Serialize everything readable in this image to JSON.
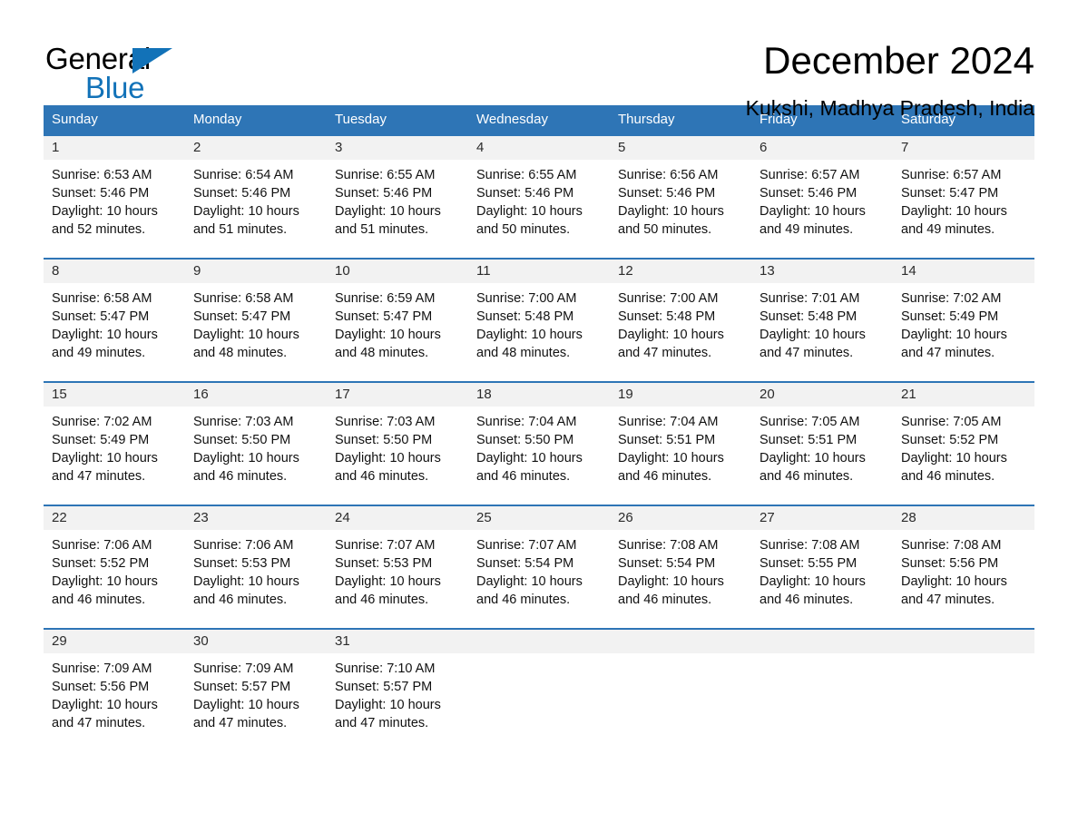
{
  "brand": {
    "name_part1": "General",
    "name_part2": "Blue",
    "accent_color": "#1272b8",
    "header_color": "#2e75b6"
  },
  "header": {
    "title": "December 2024",
    "location": "Kukshi, Madhya Pradesh, India"
  },
  "calendar": {
    "day_headers": [
      "Sunday",
      "Monday",
      "Tuesday",
      "Wednesday",
      "Thursday",
      "Friday",
      "Saturday"
    ],
    "weeks": [
      [
        {
          "day": "1",
          "sunrise": "Sunrise: 6:53 AM",
          "sunset": "Sunset: 5:46 PM",
          "daylight_line1": "Daylight: 10 hours",
          "daylight_line2": "and 52 minutes."
        },
        {
          "day": "2",
          "sunrise": "Sunrise: 6:54 AM",
          "sunset": "Sunset: 5:46 PM",
          "daylight_line1": "Daylight: 10 hours",
          "daylight_line2": "and 51 minutes."
        },
        {
          "day": "3",
          "sunrise": "Sunrise: 6:55 AM",
          "sunset": "Sunset: 5:46 PM",
          "daylight_line1": "Daylight: 10 hours",
          "daylight_line2": "and 51 minutes."
        },
        {
          "day": "4",
          "sunrise": "Sunrise: 6:55 AM",
          "sunset": "Sunset: 5:46 PM",
          "daylight_line1": "Daylight: 10 hours",
          "daylight_line2": "and 50 minutes."
        },
        {
          "day": "5",
          "sunrise": "Sunrise: 6:56 AM",
          "sunset": "Sunset: 5:46 PM",
          "daylight_line1": "Daylight: 10 hours",
          "daylight_line2": "and 50 minutes."
        },
        {
          "day": "6",
          "sunrise": "Sunrise: 6:57 AM",
          "sunset": "Sunset: 5:46 PM",
          "daylight_line1": "Daylight: 10 hours",
          "daylight_line2": "and 49 minutes."
        },
        {
          "day": "7",
          "sunrise": "Sunrise: 6:57 AM",
          "sunset": "Sunset: 5:47 PM",
          "daylight_line1": "Daylight: 10 hours",
          "daylight_line2": "and 49 minutes."
        }
      ],
      [
        {
          "day": "8",
          "sunrise": "Sunrise: 6:58 AM",
          "sunset": "Sunset: 5:47 PM",
          "daylight_line1": "Daylight: 10 hours",
          "daylight_line2": "and 49 minutes."
        },
        {
          "day": "9",
          "sunrise": "Sunrise: 6:58 AM",
          "sunset": "Sunset: 5:47 PM",
          "daylight_line1": "Daylight: 10 hours",
          "daylight_line2": "and 48 minutes."
        },
        {
          "day": "10",
          "sunrise": "Sunrise: 6:59 AM",
          "sunset": "Sunset: 5:47 PM",
          "daylight_line1": "Daylight: 10 hours",
          "daylight_line2": "and 48 minutes."
        },
        {
          "day": "11",
          "sunrise": "Sunrise: 7:00 AM",
          "sunset": "Sunset: 5:48 PM",
          "daylight_line1": "Daylight: 10 hours",
          "daylight_line2": "and 48 minutes."
        },
        {
          "day": "12",
          "sunrise": "Sunrise: 7:00 AM",
          "sunset": "Sunset: 5:48 PM",
          "daylight_line1": "Daylight: 10 hours",
          "daylight_line2": "and 47 minutes."
        },
        {
          "day": "13",
          "sunrise": "Sunrise: 7:01 AM",
          "sunset": "Sunset: 5:48 PM",
          "daylight_line1": "Daylight: 10 hours",
          "daylight_line2": "and 47 minutes."
        },
        {
          "day": "14",
          "sunrise": "Sunrise: 7:02 AM",
          "sunset": "Sunset: 5:49 PM",
          "daylight_line1": "Daylight: 10 hours",
          "daylight_line2": "and 47 minutes."
        }
      ],
      [
        {
          "day": "15",
          "sunrise": "Sunrise: 7:02 AM",
          "sunset": "Sunset: 5:49 PM",
          "daylight_line1": "Daylight: 10 hours",
          "daylight_line2": "and 47 minutes."
        },
        {
          "day": "16",
          "sunrise": "Sunrise: 7:03 AM",
          "sunset": "Sunset: 5:50 PM",
          "daylight_line1": "Daylight: 10 hours",
          "daylight_line2": "and 46 minutes."
        },
        {
          "day": "17",
          "sunrise": "Sunrise: 7:03 AM",
          "sunset": "Sunset: 5:50 PM",
          "daylight_line1": "Daylight: 10 hours",
          "daylight_line2": "and 46 minutes."
        },
        {
          "day": "18",
          "sunrise": "Sunrise: 7:04 AM",
          "sunset": "Sunset: 5:50 PM",
          "daylight_line1": "Daylight: 10 hours",
          "daylight_line2": "and 46 minutes."
        },
        {
          "day": "19",
          "sunrise": "Sunrise: 7:04 AM",
          "sunset": "Sunset: 5:51 PM",
          "daylight_line1": "Daylight: 10 hours",
          "daylight_line2": "and 46 minutes."
        },
        {
          "day": "20",
          "sunrise": "Sunrise: 7:05 AM",
          "sunset": "Sunset: 5:51 PM",
          "daylight_line1": "Daylight: 10 hours",
          "daylight_line2": "and 46 minutes."
        },
        {
          "day": "21",
          "sunrise": "Sunrise: 7:05 AM",
          "sunset": "Sunset: 5:52 PM",
          "daylight_line1": "Daylight: 10 hours",
          "daylight_line2": "and 46 minutes."
        }
      ],
      [
        {
          "day": "22",
          "sunrise": "Sunrise: 7:06 AM",
          "sunset": "Sunset: 5:52 PM",
          "daylight_line1": "Daylight: 10 hours",
          "daylight_line2": "and 46 minutes."
        },
        {
          "day": "23",
          "sunrise": "Sunrise: 7:06 AM",
          "sunset": "Sunset: 5:53 PM",
          "daylight_line1": "Daylight: 10 hours",
          "daylight_line2": "and 46 minutes."
        },
        {
          "day": "24",
          "sunrise": "Sunrise: 7:07 AM",
          "sunset": "Sunset: 5:53 PM",
          "daylight_line1": "Daylight: 10 hours",
          "daylight_line2": "and 46 minutes."
        },
        {
          "day": "25",
          "sunrise": "Sunrise: 7:07 AM",
          "sunset": "Sunset: 5:54 PM",
          "daylight_line1": "Daylight: 10 hours",
          "daylight_line2": "and 46 minutes."
        },
        {
          "day": "26",
          "sunrise": "Sunrise: 7:08 AM",
          "sunset": "Sunset: 5:54 PM",
          "daylight_line1": "Daylight: 10 hours",
          "daylight_line2": "and 46 minutes."
        },
        {
          "day": "27",
          "sunrise": "Sunrise: 7:08 AM",
          "sunset": "Sunset: 5:55 PM",
          "daylight_line1": "Daylight: 10 hours",
          "daylight_line2": "and 46 minutes."
        },
        {
          "day": "28",
          "sunrise": "Sunrise: 7:08 AM",
          "sunset": "Sunset: 5:56 PM",
          "daylight_line1": "Daylight: 10 hours",
          "daylight_line2": "and 47 minutes."
        }
      ],
      [
        {
          "day": "29",
          "sunrise": "Sunrise: 7:09 AM",
          "sunset": "Sunset: 5:56 PM",
          "daylight_line1": "Daylight: 10 hours",
          "daylight_line2": "and 47 minutes."
        },
        {
          "day": "30",
          "sunrise": "Sunrise: 7:09 AM",
          "sunset": "Sunset: 5:57 PM",
          "daylight_line1": "Daylight: 10 hours",
          "daylight_line2": "and 47 minutes."
        },
        {
          "day": "31",
          "sunrise": "Sunrise: 7:10 AM",
          "sunset": "Sunset: 5:57 PM",
          "daylight_line1": "Daylight: 10 hours",
          "daylight_line2": "and 47 minutes."
        },
        {
          "day": "",
          "sunrise": "",
          "sunset": "",
          "daylight_line1": "",
          "daylight_line2": ""
        },
        {
          "day": "",
          "sunrise": "",
          "sunset": "",
          "daylight_line1": "",
          "daylight_line2": ""
        },
        {
          "day": "",
          "sunrise": "",
          "sunset": "",
          "daylight_line1": "",
          "daylight_line2": ""
        },
        {
          "day": "",
          "sunrise": "",
          "sunset": "",
          "daylight_line1": "",
          "daylight_line2": ""
        }
      ]
    ]
  }
}
